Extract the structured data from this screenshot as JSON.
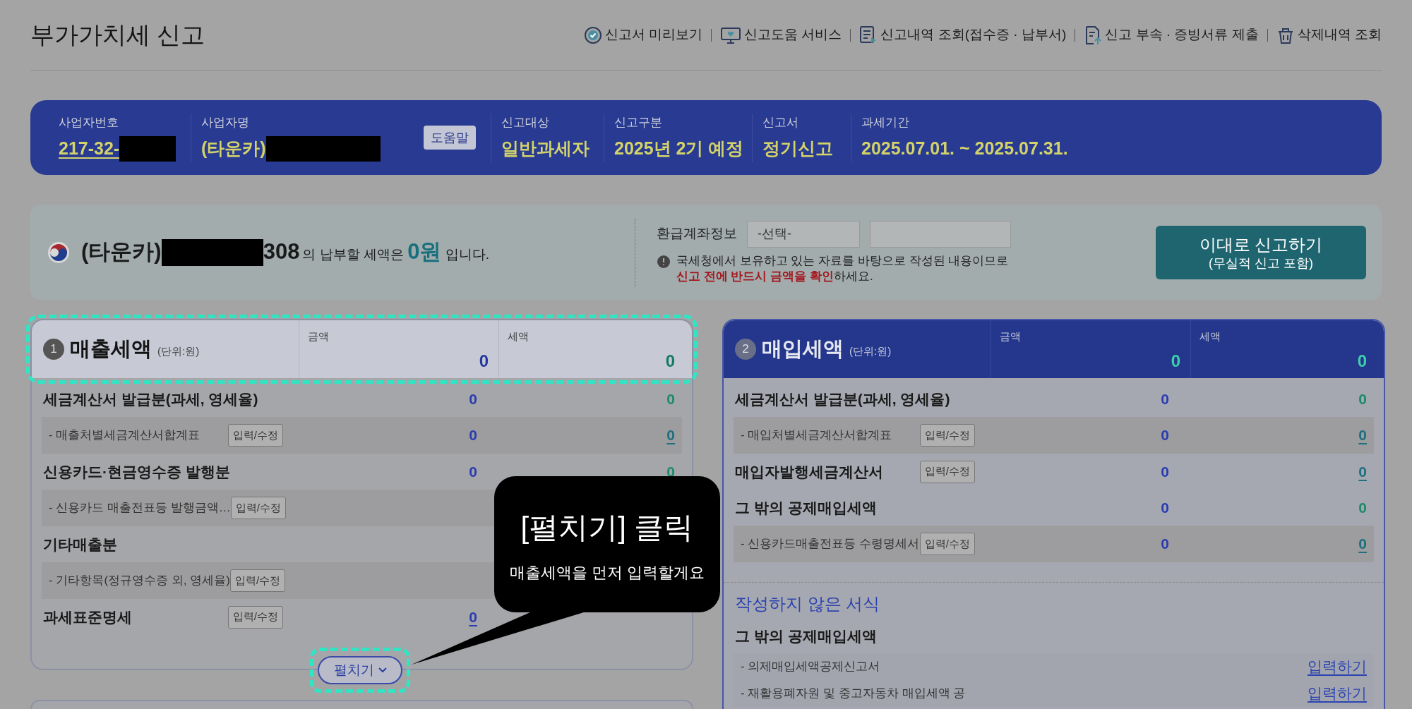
{
  "page_title": "부가가치세 신고",
  "top_links": [
    {
      "label": "신고서 미리보기"
    },
    {
      "label": "신고도움 서비스"
    },
    {
      "label": "신고내역 조회(접수증 · 납부서)"
    },
    {
      "label": "신고 부속 · 증빙서류 제출"
    },
    {
      "label": "삭제내역 조회"
    }
  ],
  "business_bar": {
    "help_button": "도움말",
    "fields": [
      {
        "label": "사업자번호",
        "value": "217-32-",
        "redacted": true,
        "underlined": true
      },
      {
        "label": "사업자명",
        "value": "(타운카)",
        "redacted": true,
        "underlined": false
      },
      {
        "label": "신고대상",
        "value": "일반과세자",
        "redacted": false,
        "underlined": false
      },
      {
        "label": "신고구분",
        "value": "2025년 2기 예정",
        "redacted": false,
        "underlined": false
      },
      {
        "label": "신고서",
        "value": "정기신고",
        "redacted": false,
        "underlined": false
      },
      {
        "label": "과세기간",
        "value": "2025.07.01. ~ 2025.07.31.",
        "redacted": false,
        "underlined": false
      }
    ]
  },
  "summary": {
    "name_prefix": "(타운카)",
    "name_suffix": "308",
    "text_before": "의 납부할 세액은",
    "amount": "0원",
    "text_after": "입니다.",
    "refund_label": "환급계좌정보",
    "select_placeholder": "-선택-",
    "notice_text": "국세청에서 보유하고 있는 자료를 바탕으로 작성된 내용이므로",
    "notice_warning": "신고 전에 반드시 금액을 확인",
    "notice_end": "하세요.",
    "submit_button": {
      "title": "이대로 신고하기",
      "subtitle": "(무실적 신고 포함)"
    }
  },
  "sections": [
    {
      "number": "1",
      "title": "매출세액",
      "unit": "(단위:원)",
      "highlighted": true,
      "columns": [
        "금액",
        "세액"
      ],
      "totals": [
        "0",
        "0"
      ],
      "expand_button": "펼치기",
      "rows": [
        {
          "kind": "main",
          "label": "세금계산서 발급분(과세, 영세율)",
          "amount": "0",
          "tax": "0",
          "tax_link": false
        },
        {
          "kind": "sub",
          "label": "- 매출처별세금계산서합계표",
          "button": "입력/수정",
          "amount": "0",
          "tax": "0",
          "tax_link": true
        },
        {
          "kind": "main",
          "label": "신용카드·현금영수증 발행분",
          "amount": "0",
          "tax": "0",
          "tax_link": false
        },
        {
          "kind": "sub",
          "label": "- 신용카드 매출전표등 발행금액…",
          "button": "입력/수정"
        },
        {
          "kind": "main",
          "label": "기타매출분"
        },
        {
          "kind": "sub",
          "label": "- 기타항목(정규영수증 외, 영세율)",
          "button": "입력/수정"
        },
        {
          "kind": "main",
          "label": "과세표준명세",
          "button": "입력/수정",
          "amount": "0",
          "amount_link": true
        }
      ]
    },
    {
      "number": "2",
      "title": "매입세액",
      "unit": "(단위:원)",
      "highlighted": false,
      "columns": [
        "금액",
        "세액"
      ],
      "totals": [
        "0",
        "0"
      ],
      "rows": [
        {
          "kind": "main",
          "label": "세금계산서 발급분(과세, 영세율)",
          "amount": "0",
          "tax": "0",
          "tax_link": false
        },
        {
          "kind": "sub",
          "label": "- 매입처별세금계산서합계표",
          "button": "입력/수정",
          "amount": "0",
          "tax": "0",
          "tax_link": true
        },
        {
          "kind": "main",
          "label": "매입자발행세금계산서",
          "button": "입력/수정",
          "amount": "0",
          "tax": "0",
          "tax_link": true
        },
        {
          "kind": "main",
          "label": "그 밖의 공제매입세액",
          "amount": "0",
          "tax": "0",
          "tax_link": false
        },
        {
          "kind": "sub",
          "label": "- 신용카드매출전표등 수령명세서",
          "button": "입력/수정",
          "amount": "0",
          "tax": "0",
          "tax_link": true
        }
      ],
      "unwritten_title": "작성하지 않은 서식",
      "unwritten_groups": [
        {
          "title": "그 밖의 공제매입세액",
          "items": [
            {
              "label": "- 의제매입세액공제신고서",
              "action": "입력하기"
            },
            {
              "label": "- 재활용폐자원 및 중고자동차 매입세액 공",
              "action": "입력하기"
            }
          ]
        }
      ]
    }
  ],
  "tooltip": {
    "title": "[펼치기] 클릭",
    "text": "매출세액을 먼저 입력할게요"
  }
}
